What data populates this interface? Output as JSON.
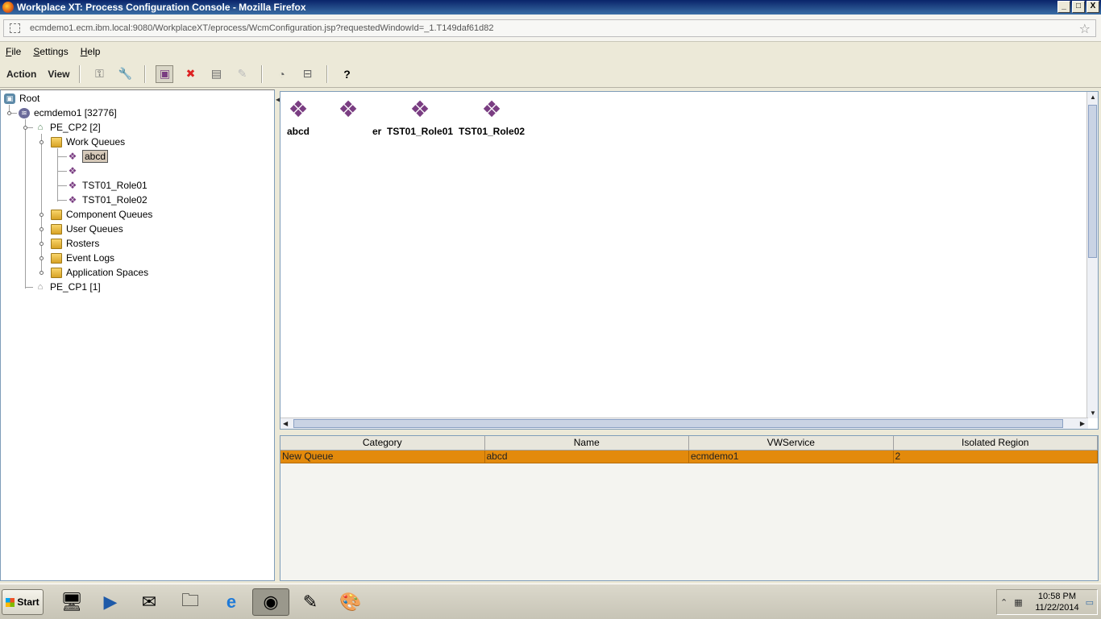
{
  "window": {
    "title": "Workplace XT: Process Configuration Console - Mozilla Firefox",
    "buttons": {
      "minimize": "_",
      "maximize": "□",
      "close": "X"
    }
  },
  "browser": {
    "url": "ecmdemo1.ecm.ibm.local:9080/WorkplaceXT/eprocess/WcmConfiguration.jsp?requestedWindowId=_1.T149daf61d82"
  },
  "menu": {
    "items": [
      "File",
      "Settings",
      "Help"
    ]
  },
  "toolbar": {
    "action_label": "Action",
    "view_label": "View",
    "help_glyph": "?",
    "delete_glyph": "✖"
  },
  "tree": {
    "root": "Root",
    "server": "ecmdemo1 [32776]",
    "region1": "PE_CP2 [2]",
    "work_queues": "Work Queues",
    "queue_abcd": "abcd",
    "queue_obscured": "",
    "queue_role01": "TST01_Role01",
    "queue_role02": "TST01_Role02",
    "component_queues": "Component Queues",
    "user_queues": "User Queues",
    "rosters": "Rosters",
    "event_logs": "Event Logs",
    "application_spaces": "Application Spaces",
    "region2": "PE_CP1 [1]"
  },
  "icon_view": {
    "items": [
      "abcd",
      "",
      "TST01_Role01",
      "TST01_Role02"
    ],
    "partial_label": "er"
  },
  "table": {
    "headers": [
      "Category",
      "Name",
      "VWService",
      "Isolated Region"
    ],
    "rows": [
      [
        "New Queue",
        "abcd",
        "ecmdemo1",
        "2"
      ]
    ]
  },
  "taskbar": {
    "start_label": "Start",
    "time": "10:58 PM",
    "date": "11/22/2014"
  },
  "colors": {
    "selected_row": "#e38a0c",
    "titlebar": "#0a246a"
  }
}
